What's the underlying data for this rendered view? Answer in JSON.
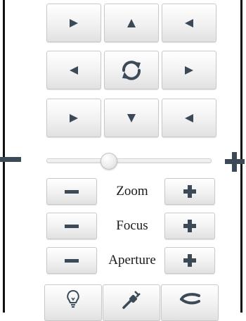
{
  "ptz_panel": {
    "direction_buttons": [
      {
        "name": "pan-up-left-button",
        "icon": "triangle-pointing-right"
      },
      {
        "name": "pan-up-button",
        "icon": "triangle-pointing-up"
      },
      {
        "name": "pan-up-right-button",
        "icon": "triangle-pointing-left"
      },
      {
        "name": "pan-left-button",
        "icon": "triangle-pointing-left"
      },
      {
        "name": "auto-rotate-button",
        "icon": "refresh-icon"
      },
      {
        "name": "pan-right-button",
        "icon": "triangle-pointing-right"
      },
      {
        "name": "pan-down-left-button",
        "icon": "triangle-pointing-right"
      },
      {
        "name": "pan-down-button",
        "icon": "triangle-pointing-down"
      },
      {
        "name": "pan-down-right-button",
        "icon": "triangle-pointing-left"
      }
    ],
    "speed_slider": {
      "value_fraction": 0.38
    },
    "adjust_rows": [
      {
        "label": "Zoom"
      },
      {
        "label": "Focus"
      },
      {
        "label": "Aperture"
      }
    ],
    "bottom_tools": [
      {
        "icon": "lightbulb-icon"
      },
      {
        "icon": "wiper-icon"
      },
      {
        "icon": "link-icon"
      }
    ]
  },
  "colors": {
    "icon": "#3c4a57",
    "frame": "#111111",
    "button_top": "#ffffff",
    "button_bottom": "#e1e1e1"
  }
}
